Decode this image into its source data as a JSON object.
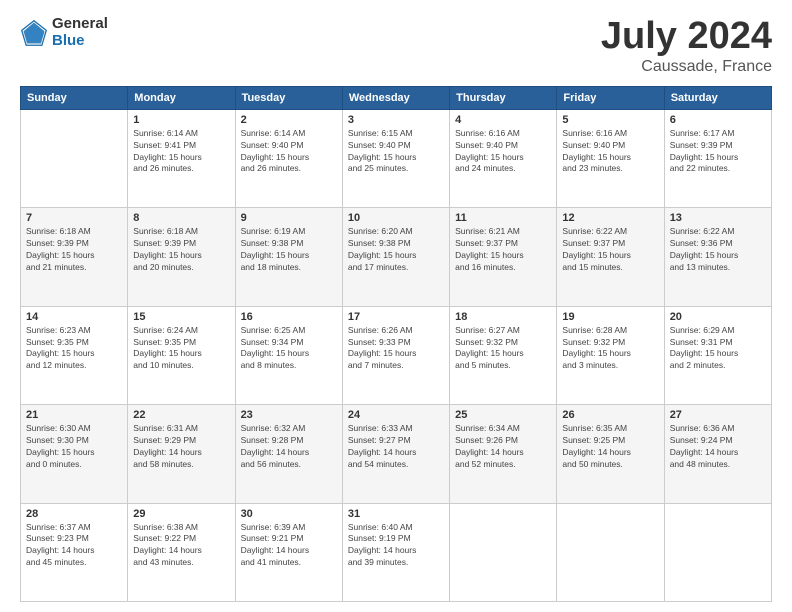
{
  "logo": {
    "general": "General",
    "blue": "Blue"
  },
  "header": {
    "month": "July 2024",
    "location": "Caussade, France"
  },
  "days_of_week": [
    "Sunday",
    "Monday",
    "Tuesday",
    "Wednesday",
    "Thursday",
    "Friday",
    "Saturday"
  ],
  "weeks": [
    [
      {
        "day": "",
        "details": ""
      },
      {
        "day": "1",
        "details": "Sunrise: 6:14 AM\nSunset: 9:41 PM\nDaylight: 15 hours\nand 26 minutes."
      },
      {
        "day": "2",
        "details": "Sunrise: 6:14 AM\nSunset: 9:40 PM\nDaylight: 15 hours\nand 26 minutes."
      },
      {
        "day": "3",
        "details": "Sunrise: 6:15 AM\nSunset: 9:40 PM\nDaylight: 15 hours\nand 25 minutes."
      },
      {
        "day": "4",
        "details": "Sunrise: 6:16 AM\nSunset: 9:40 PM\nDaylight: 15 hours\nand 24 minutes."
      },
      {
        "day": "5",
        "details": "Sunrise: 6:16 AM\nSunset: 9:40 PM\nDaylight: 15 hours\nand 23 minutes."
      },
      {
        "day": "6",
        "details": "Sunrise: 6:17 AM\nSunset: 9:39 PM\nDaylight: 15 hours\nand 22 minutes."
      }
    ],
    [
      {
        "day": "7",
        "details": "Sunrise: 6:18 AM\nSunset: 9:39 PM\nDaylight: 15 hours\nand 21 minutes."
      },
      {
        "day": "8",
        "details": "Sunrise: 6:18 AM\nSunset: 9:39 PM\nDaylight: 15 hours\nand 20 minutes."
      },
      {
        "day": "9",
        "details": "Sunrise: 6:19 AM\nSunset: 9:38 PM\nDaylight: 15 hours\nand 18 minutes."
      },
      {
        "day": "10",
        "details": "Sunrise: 6:20 AM\nSunset: 9:38 PM\nDaylight: 15 hours\nand 17 minutes."
      },
      {
        "day": "11",
        "details": "Sunrise: 6:21 AM\nSunset: 9:37 PM\nDaylight: 15 hours\nand 16 minutes."
      },
      {
        "day": "12",
        "details": "Sunrise: 6:22 AM\nSunset: 9:37 PM\nDaylight: 15 hours\nand 15 minutes."
      },
      {
        "day": "13",
        "details": "Sunrise: 6:22 AM\nSunset: 9:36 PM\nDaylight: 15 hours\nand 13 minutes."
      }
    ],
    [
      {
        "day": "14",
        "details": "Sunrise: 6:23 AM\nSunset: 9:35 PM\nDaylight: 15 hours\nand 12 minutes."
      },
      {
        "day": "15",
        "details": "Sunrise: 6:24 AM\nSunset: 9:35 PM\nDaylight: 15 hours\nand 10 minutes."
      },
      {
        "day": "16",
        "details": "Sunrise: 6:25 AM\nSunset: 9:34 PM\nDaylight: 15 hours\nand 8 minutes."
      },
      {
        "day": "17",
        "details": "Sunrise: 6:26 AM\nSunset: 9:33 PM\nDaylight: 15 hours\nand 7 minutes."
      },
      {
        "day": "18",
        "details": "Sunrise: 6:27 AM\nSunset: 9:32 PM\nDaylight: 15 hours\nand 5 minutes."
      },
      {
        "day": "19",
        "details": "Sunrise: 6:28 AM\nSunset: 9:32 PM\nDaylight: 15 hours\nand 3 minutes."
      },
      {
        "day": "20",
        "details": "Sunrise: 6:29 AM\nSunset: 9:31 PM\nDaylight: 15 hours\nand 2 minutes."
      }
    ],
    [
      {
        "day": "21",
        "details": "Sunrise: 6:30 AM\nSunset: 9:30 PM\nDaylight: 15 hours\nand 0 minutes."
      },
      {
        "day": "22",
        "details": "Sunrise: 6:31 AM\nSunset: 9:29 PM\nDaylight: 14 hours\nand 58 minutes."
      },
      {
        "day": "23",
        "details": "Sunrise: 6:32 AM\nSunset: 9:28 PM\nDaylight: 14 hours\nand 56 minutes."
      },
      {
        "day": "24",
        "details": "Sunrise: 6:33 AM\nSunset: 9:27 PM\nDaylight: 14 hours\nand 54 minutes."
      },
      {
        "day": "25",
        "details": "Sunrise: 6:34 AM\nSunset: 9:26 PM\nDaylight: 14 hours\nand 52 minutes."
      },
      {
        "day": "26",
        "details": "Sunrise: 6:35 AM\nSunset: 9:25 PM\nDaylight: 14 hours\nand 50 minutes."
      },
      {
        "day": "27",
        "details": "Sunrise: 6:36 AM\nSunset: 9:24 PM\nDaylight: 14 hours\nand 48 minutes."
      }
    ],
    [
      {
        "day": "28",
        "details": "Sunrise: 6:37 AM\nSunset: 9:23 PM\nDaylight: 14 hours\nand 45 minutes."
      },
      {
        "day": "29",
        "details": "Sunrise: 6:38 AM\nSunset: 9:22 PM\nDaylight: 14 hours\nand 43 minutes."
      },
      {
        "day": "30",
        "details": "Sunrise: 6:39 AM\nSunset: 9:21 PM\nDaylight: 14 hours\nand 41 minutes."
      },
      {
        "day": "31",
        "details": "Sunrise: 6:40 AM\nSunset: 9:19 PM\nDaylight: 14 hours\nand 39 minutes."
      },
      {
        "day": "",
        "details": ""
      },
      {
        "day": "",
        "details": ""
      },
      {
        "day": "",
        "details": ""
      }
    ]
  ]
}
